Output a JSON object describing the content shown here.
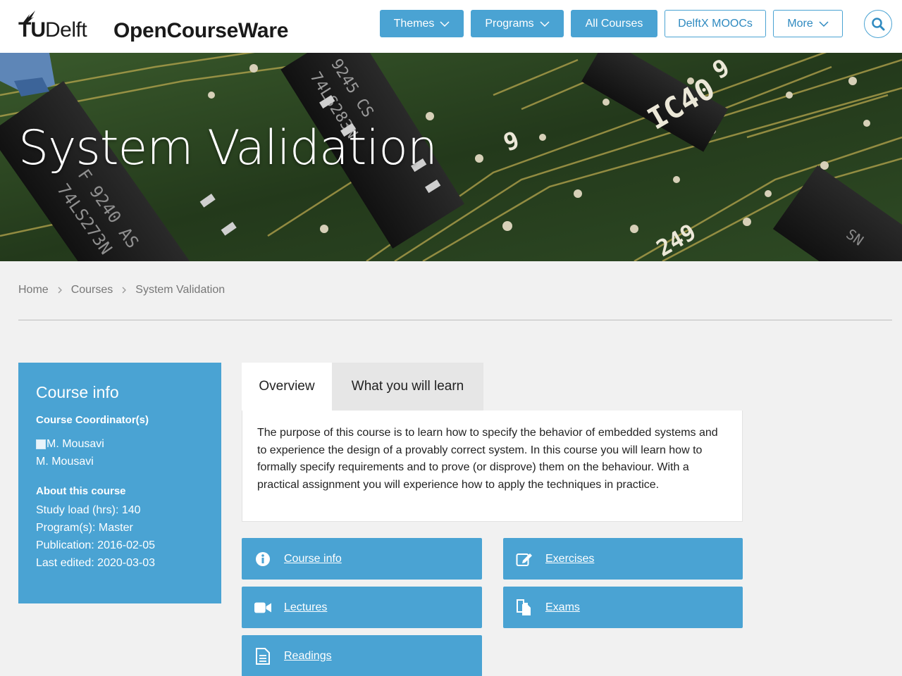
{
  "header": {
    "logo_tu": "TU",
    "logo_delft": "Delft",
    "brand": "OpenCourseWare",
    "nav": [
      {
        "label": "Themes"
      },
      {
        "label": "Programs"
      },
      {
        "label": "All Courses"
      },
      {
        "label": "DelftX MOOCs"
      },
      {
        "label": "More"
      }
    ]
  },
  "hero": {
    "title": "System Validation",
    "chip_labels": [
      "9245 CS",
      "74LS283N",
      "F 9240 AS",
      "74LS273N",
      "IC40",
      "9",
      "9",
      "249",
      "SN"
    ]
  },
  "breadcrumb": [
    {
      "label": "Home"
    },
    {
      "label": "Courses"
    },
    {
      "label": "System Validation"
    }
  ],
  "course_info": {
    "title": "Course info",
    "coordinators_label": "Course Coordinator(s)",
    "coordinator_img_alt": "M. Mousavi",
    "coordinator_name": "M. Mousavi",
    "about_label": "About this course",
    "study_load": "Study load (hrs): 140",
    "programs": "Program(s): Master",
    "publication": "Publication: 2016-02-05",
    "last_edited": "Last edited: 2020-03-03"
  },
  "tabs": [
    {
      "label": "Overview",
      "active": true
    },
    {
      "label": "What you will learn",
      "active": false
    }
  ],
  "overview_text": "The purpose of this course is to learn how to specify the behavior of embedded systems and to experience the design of a provably correct system. In this course you will learn how to formally specify requirements and to prove (or disprove) them on the behaviour. With a practical assignment you will experience how to apply the techniques in practice.",
  "tiles": {
    "course_info": "Course info",
    "exercises": "Exercises",
    "lectures": "Lectures",
    "exams": "Exams",
    "readings": "Readings"
  },
  "colors": {
    "accent": "#4aa3d3",
    "pcb_green": "#2c4a22",
    "background": "#f1f1f1"
  }
}
